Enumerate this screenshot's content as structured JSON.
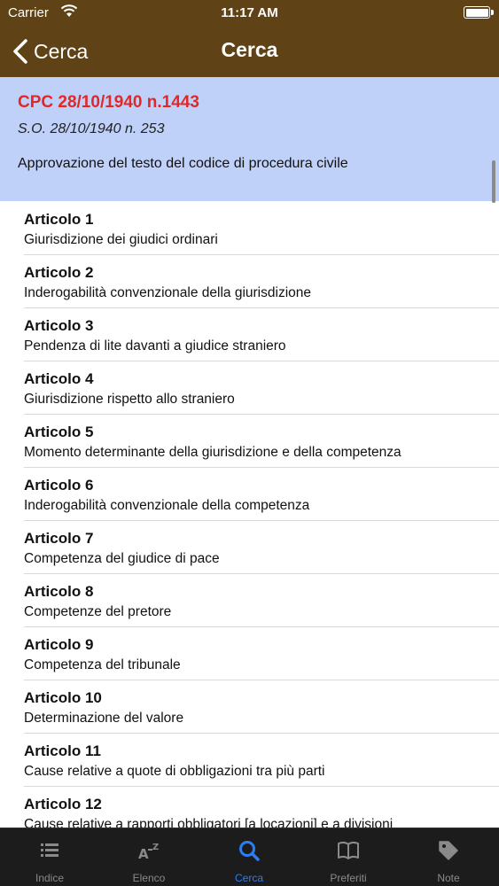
{
  "status": {
    "carrier": "Carrier",
    "time": "11:17 AM"
  },
  "nav": {
    "back_label": "Cerca",
    "title": "Cerca"
  },
  "header": {
    "code": "CPC 28/10/1940 n.1443",
    "so": "S.O. 28/10/1940 n. 253",
    "description": "Approvazione del testo del codice di procedura civile"
  },
  "articles": [
    {
      "title": "Articolo 1",
      "subtitle": "Giurisdizione dei giudici ordinari"
    },
    {
      "title": "Articolo 2",
      "subtitle": "Inderogabilità convenzionale della giurisdizione"
    },
    {
      "title": "Articolo 3",
      "subtitle": "Pendenza di lite davanti a giudice straniero"
    },
    {
      "title": "Articolo 4",
      "subtitle": "Giurisdizione rispetto allo straniero"
    },
    {
      "title": "Articolo 5",
      "subtitle": "Momento determinante della giurisdizione e della competenza"
    },
    {
      "title": "Articolo 6",
      "subtitle": "Inderogabilità convenzionale della competenza"
    },
    {
      "title": "Articolo 7",
      "subtitle": "Competenza del giudice di pace"
    },
    {
      "title": "Articolo 8",
      "subtitle": "Competenze del pretore"
    },
    {
      "title": "Articolo 9",
      "subtitle": "Competenza del tribunale"
    },
    {
      "title": "Articolo 10",
      "subtitle": "Determinazione del valore"
    },
    {
      "title": "Articolo 11",
      "subtitle": "Cause relative a quote di obbligazioni tra più parti"
    },
    {
      "title": "Articolo 12",
      "subtitle": "Cause relative a rapporti obbligatori [a locazioni] e a divisioni"
    }
  ],
  "tabs": [
    {
      "label": "Indice",
      "icon": "list-icon"
    },
    {
      "label": "Elenco",
      "icon": "az-sort-icon"
    },
    {
      "label": "Cerca",
      "icon": "search-icon",
      "active": true
    },
    {
      "label": "Preferiti",
      "icon": "book-icon"
    },
    {
      "label": "Note",
      "icon": "tag-icon"
    }
  ],
  "colors": {
    "nav_bar": "#5f4317",
    "header_bg": "#bfd1f9",
    "code_red": "#e32726",
    "tab_active": "#2a7ef7",
    "tab_inactive": "#8a8a8a",
    "tab_bar": "#1c1c1c"
  }
}
